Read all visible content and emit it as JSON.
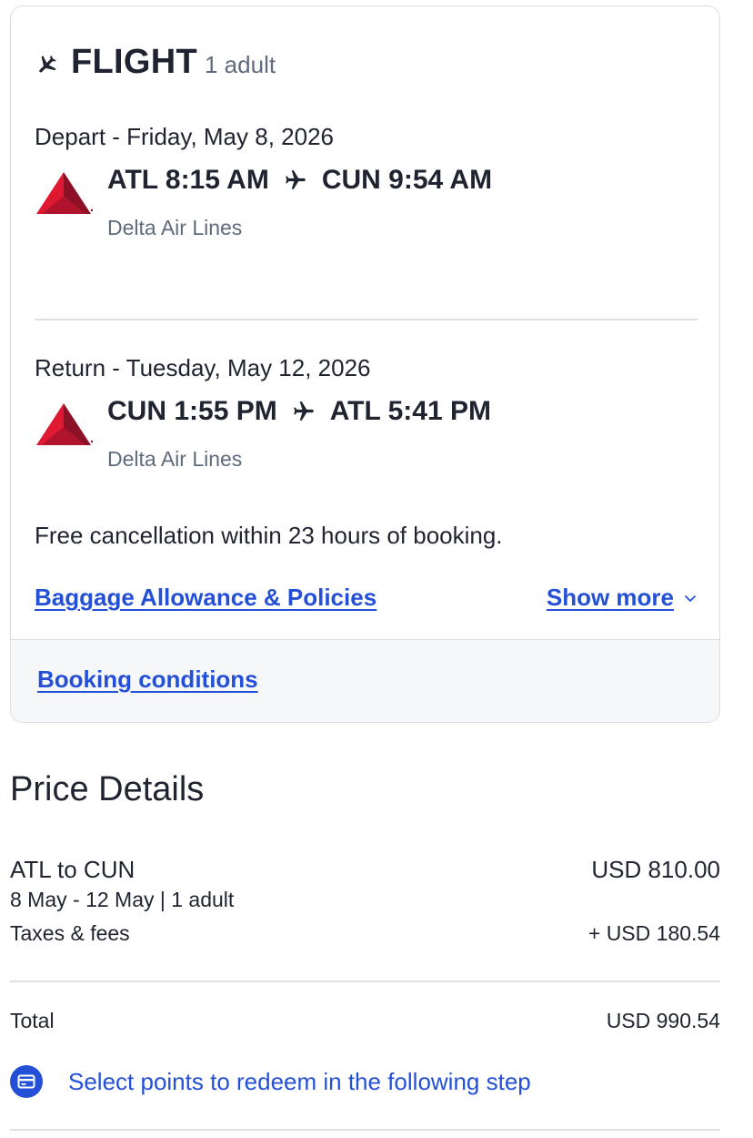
{
  "flight_card": {
    "title": "FLIGHT",
    "passengers": "1 adult",
    "depart": {
      "date_label": "Depart - Friday, May 8, 2026",
      "from": "ATL 8:15 AM",
      "to": "CUN 9:54 AM",
      "airline": "Delta Air Lines"
    },
    "return": {
      "date_label": "Return - Tuesday, May 12, 2026",
      "from": "CUN 1:55 PM",
      "to": "ATL 5:41 PM",
      "airline": "Delta Air Lines"
    },
    "cancellation_note": "Free cancellation within 23 hours of booking.",
    "baggage_link": "Baggage Allowance & Policies",
    "show_more": "Show more",
    "booking_conditions": "Booking conditions"
  },
  "price_details": {
    "title": "Price Details",
    "route_label": "ATL to CUN",
    "route_price": "USD 810.00",
    "dates_pax": "8 May - 12 May | 1 adult",
    "taxes_label": "Taxes & fees",
    "taxes_value": "+ USD 180.54",
    "total_label": "Total",
    "total_value": "USD 990.54",
    "points_text": "Select points to redeem in the following step"
  },
  "colors": {
    "link": "#2450d8",
    "delta_red_light": "#e01933",
    "delta_red_dark": "#8c1127",
    "text": "#1f2430",
    "muted": "#5f6b7c"
  }
}
